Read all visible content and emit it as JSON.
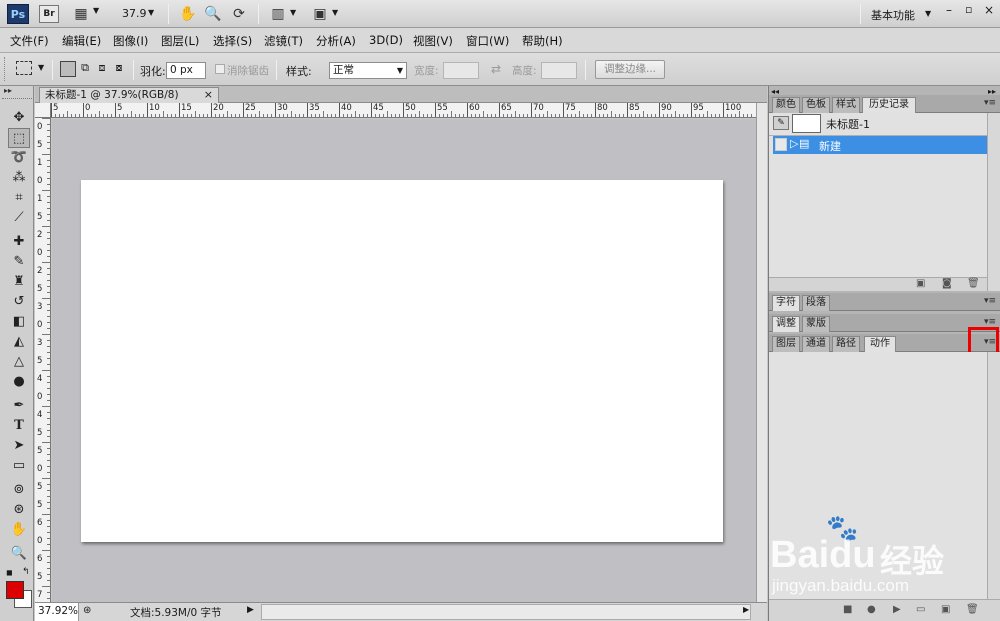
{
  "appbar": {
    "ps_logo": "Ps",
    "br_logo": "Br",
    "zoom": "37.9",
    "workspace": "基本功能"
  },
  "menu": [
    "文件(F)",
    "编辑(E)",
    "图像(I)",
    "图层(L)",
    "选择(S)",
    "滤镜(T)",
    "分析(A)",
    "3D(D)",
    "视图(V)",
    "窗口(W)",
    "帮助(H)"
  ],
  "options": {
    "feather_label": "羽化:",
    "feather_value": "0 px",
    "antialias_label": "消除锯齿",
    "style_label": "样式:",
    "style_value": "正常",
    "width_label": "宽度:",
    "height_label": "高度:",
    "refine_edge": "调整边缘..."
  },
  "document": {
    "tab_title": "未标题-1 @ 37.9%(RGB/8)",
    "close": "×",
    "ruler_h": [
      "5",
      "0",
      "5",
      "10",
      "15",
      "20",
      "25",
      "30",
      "35",
      "40",
      "45",
      "50",
      "55",
      "60",
      "65",
      "70",
      "75",
      "80",
      "85",
      "90",
      "95",
      "100"
    ],
    "ruler_v": [
      "0",
      "5",
      "1",
      "0",
      "1",
      "5",
      "2",
      "0",
      "2",
      "5",
      "3",
      "0",
      "3",
      "5",
      "4",
      "0",
      "4",
      "5",
      "5",
      "0",
      "5",
      "5",
      "6",
      "0",
      "6",
      "5",
      "7",
      "0"
    ]
  },
  "status": {
    "zoom": "37.92%",
    "doc_info": "文档:5.93M/0 字节"
  },
  "panels": {
    "group1_tabs": [
      "颜色",
      "色板",
      "样式",
      "历史记录"
    ],
    "history_snapshot": "未标题-1",
    "history_item": "新建",
    "group2_tabs": [
      "字符",
      "段落"
    ],
    "group3_tabs": [
      "调整",
      "蒙版"
    ],
    "group4_tabs": [
      "图层",
      "通道",
      "路径",
      "动作"
    ]
  },
  "watermark": {
    "brand": "Bai",
    "brand2": "du",
    "cn": "经验",
    "url": "jingyan.baidu.com"
  },
  "colors": {
    "foreground": "#dd0000",
    "background": "#ffffff",
    "highlight": "#3c8fe3",
    "annotation_box": "#ee0000"
  }
}
